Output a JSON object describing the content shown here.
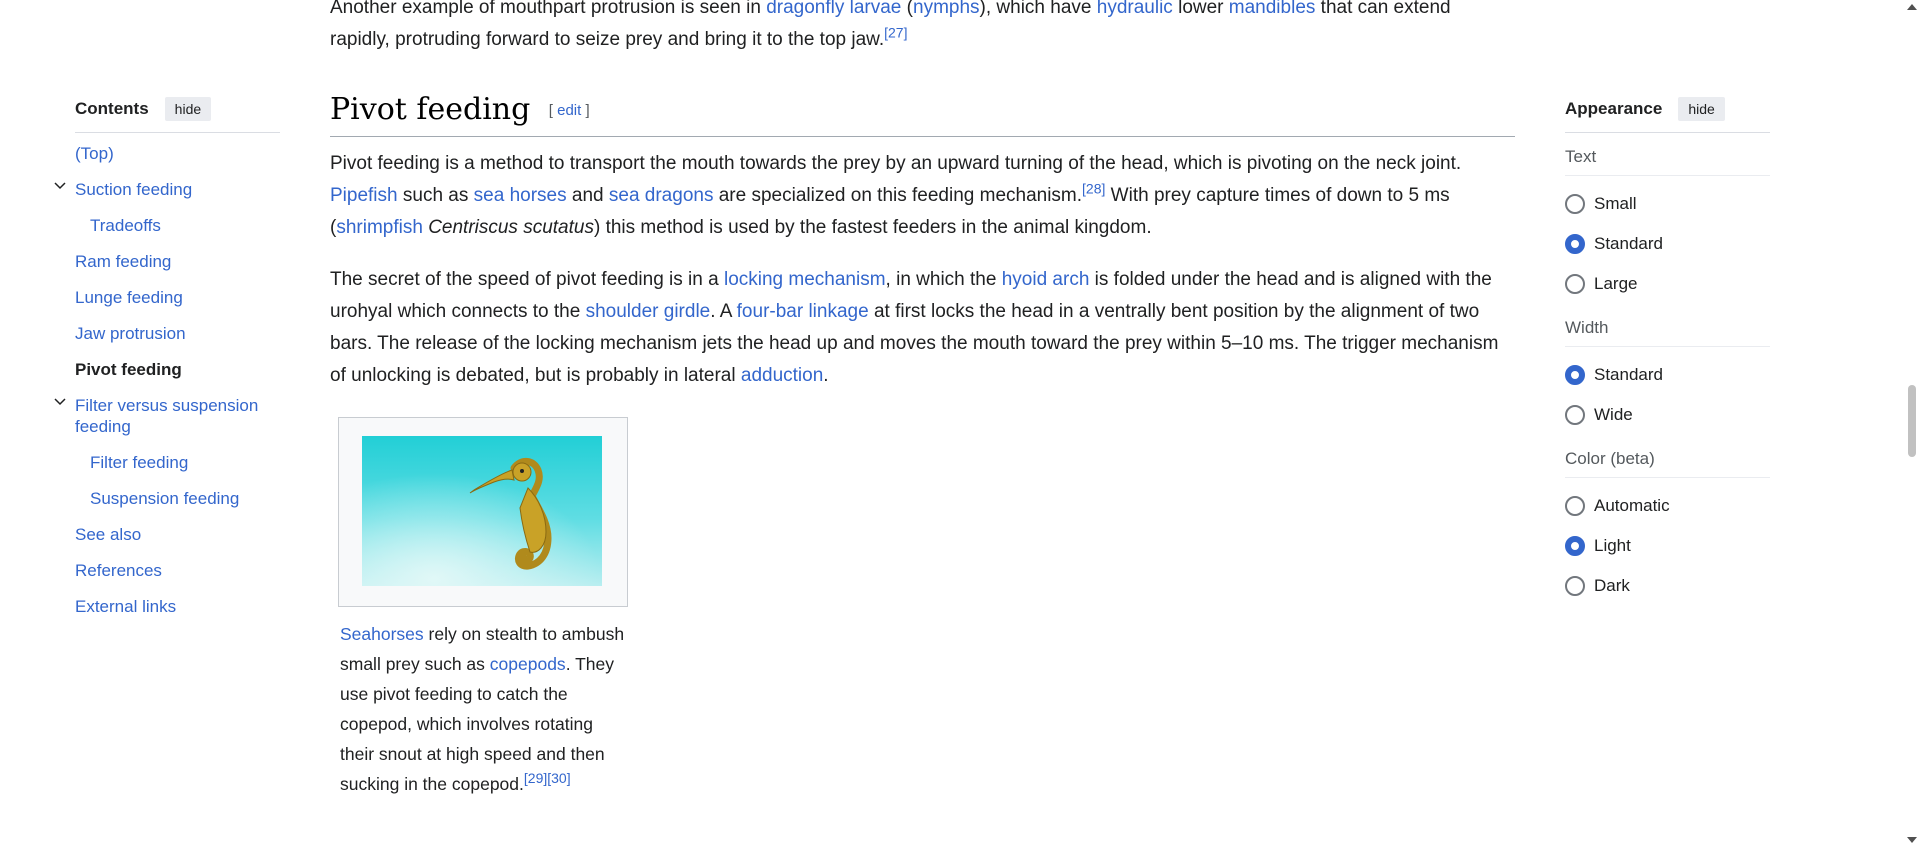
{
  "top_para": {
    "t1": "Another example of mouthpart protrusion is seen in ",
    "l1": "dragonfly larvae",
    "t2": " (",
    "l2": "nymphs",
    "t3": "), which have ",
    "l3": "hydraulic",
    "t4": " lower ",
    "l4": "mandibles",
    "t5": " that can extend rapidly, protruding forward to seize prey and bring it to the top jaw.",
    "ref": "[27]"
  },
  "toc": {
    "title": "Contents",
    "hide_label": "hide",
    "items": [
      {
        "label": "(Top)"
      },
      {
        "label": "Suction feeding"
      },
      {
        "label": "Tradeoffs"
      },
      {
        "label": "Ram feeding"
      },
      {
        "label": "Lunge feeding"
      },
      {
        "label": "Jaw protrusion"
      },
      {
        "label": "Pivot feeding"
      },
      {
        "label": "Filter versus suspension feeding"
      },
      {
        "label": "Filter feeding"
      },
      {
        "label": "Suspension feeding"
      },
      {
        "label": "See also"
      },
      {
        "label": "References"
      },
      {
        "label": "External links"
      }
    ]
  },
  "section": {
    "title": "Pivot feeding",
    "edit_open": "[ ",
    "edit_label": "edit",
    "edit_close": " ]"
  },
  "p1": {
    "t1": "Pivot feeding is a method to transport the mouth towards the prey by an upward turning of the head, which is pivoting on the neck joint. ",
    "l1": "Pipefish",
    "t2": " such as ",
    "l2": "sea horses",
    "t3": " and ",
    "l3": "sea dragons",
    "t4": " are specialized on this feeding mechanism.",
    "ref1": "[28]",
    "t5": " With prey capture times of down to 5 ms (",
    "l4": "shrimpfish",
    "t6": " ",
    "i1": "Centriscus scutatus",
    "t7": ") this method is used by the fastest feeders in the animal kingdom."
  },
  "p2": {
    "t1": "The secret of the speed of pivot feeding is in a ",
    "l1": "locking mechanism",
    "t2": ", in which the ",
    "l2": "hyoid arch",
    "t3": " is folded under the head and is aligned with the urohyal which connects to the ",
    "l3": "shoulder girdle",
    "t4": ". A ",
    "l4": "four-bar linkage",
    "t5": " at first locks the head in a ventrally bent position by the alignment of two bars. The release of the locking mechanism jets the head up and moves the mouth toward the prey within 5–10 ms. The trigger mechanism of unlocking is debated, but is probably in lateral ",
    "l5": "adduction",
    "t6": "."
  },
  "caption": {
    "l1": "Seahorses",
    "t1": " rely on stealth to ambush small prey such as ",
    "l2": "copepods",
    "t2": ". They use pivot feeding to catch the copepod, which involves rotating their snout at high speed and then sucking in the copepod.",
    "ref1": "[29]",
    "ref2": "[30]"
  },
  "appearance": {
    "title": "Appearance",
    "hide_label": "hide",
    "text_label": "Text",
    "text_options": [
      "Small",
      "Standard",
      "Large"
    ],
    "text_selected": "Standard",
    "width_label": "Width",
    "width_options": [
      "Standard",
      "Wide"
    ],
    "width_selected": "Standard",
    "color_label": "Color (beta)",
    "color_options": [
      "Automatic",
      "Light",
      "Dark"
    ],
    "color_selected": "Light"
  },
  "colors": {
    "link": "#3366cc",
    "radio_on": "#3366cc",
    "text": "#202122"
  }
}
